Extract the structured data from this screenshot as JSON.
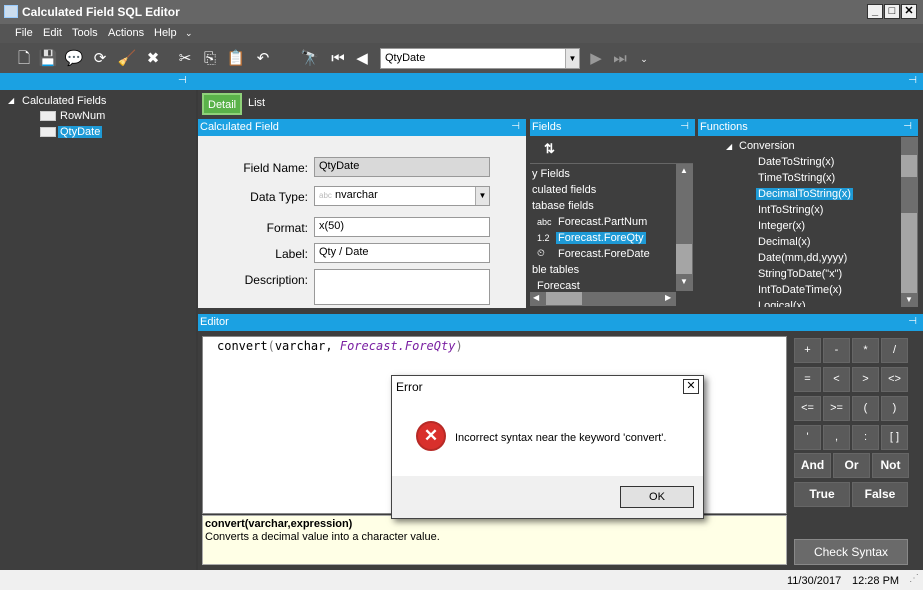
{
  "window": {
    "title": "Calculated Field SQL Editor"
  },
  "menu": [
    "File",
    "Edit",
    "Tools",
    "Actions",
    "Help"
  ],
  "toolbar": {
    "current_field": "QtyDate"
  },
  "tree": {
    "root": "Calculated Fields",
    "items": [
      "RowNum",
      "QtyDate"
    ]
  },
  "tabs": {
    "detail": "Detail",
    "list": "List"
  },
  "panes": {
    "calculated_field": "Calculated Field",
    "fields": "Fields",
    "functions": "Functions",
    "editor": "Editor"
  },
  "form": {
    "field_name_label": "Field Name:",
    "field_name": "QtyDate",
    "data_type_label": "Data Type:",
    "data_type": "nvarchar",
    "data_type_prefix": "abc",
    "format_label": "Format:",
    "format": "x(50)",
    "label_label": "Label:",
    "label": "Qty / Date",
    "description_label": "Description:",
    "description": ""
  },
  "fields_list": {
    "sort_icon": "A-Z sort",
    "items": [
      {
        "text": "y Fields",
        "prefix": ""
      },
      {
        "text": "culated fields",
        "prefix": ""
      },
      {
        "text": "tabase fields",
        "prefix": ""
      },
      {
        "text": "Forecast.PartNum",
        "prefix": "abc"
      },
      {
        "text": "Forecast.ForeQty",
        "prefix": "1.2"
      },
      {
        "text": "Forecast.ForeDate",
        "prefix": "⏲"
      },
      {
        "text": "ble tables",
        "prefix": ""
      },
      {
        "text": "Forecast",
        "prefix": ""
      }
    ]
  },
  "functions_list": {
    "group": "Conversion",
    "items": [
      "DateToString(x)",
      "TimeToString(x)",
      "DecimalToString(x)",
      "IntToString(x)",
      "Integer(x)",
      "Decimal(x)",
      "Date(mm,dd,yyyy)",
      "StringToDate(\"x\")",
      "IntToDateTime(x)",
      "Logical(x)"
    ]
  },
  "editor": {
    "code_fn": "convert",
    "code_open": "(",
    "code_arg": "varchar,",
    "code_field": "Forecast.ForeQty",
    "code_close": ")"
  },
  "help": {
    "signature": "convert(varchar,expression)",
    "description": "Converts a decimal value into a character value."
  },
  "keypad": [
    "+",
    "-",
    "*",
    "/",
    "=",
    "<",
    ">",
    "<>",
    "<=",
    ">=",
    "(",
    ")",
    "'",
    ",",
    ":",
    "[ ]"
  ],
  "logic": {
    "and": "And",
    "or": "Or",
    "not": "Not",
    "true": "True",
    "false": "False"
  },
  "check_syntax": "Check Syntax",
  "status": {
    "date": "11/30/2017",
    "time": "12:28 PM"
  },
  "dialog": {
    "title": "Error",
    "message": "Incorrect syntax near the keyword 'convert'.",
    "ok": "OK"
  },
  "colors": {
    "accent": "#1ba1e2",
    "selection": "#1e9ad6",
    "function_color": "#7a1fa2",
    "error_red": "#d9302c"
  }
}
